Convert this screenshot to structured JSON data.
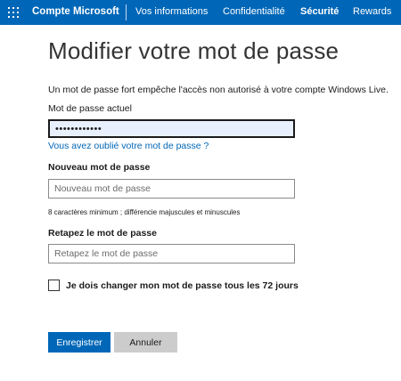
{
  "header": {
    "brand": "Compte Microsoft",
    "nav": [
      {
        "label": "Vos informations",
        "active": false
      },
      {
        "label": "Confidentialité",
        "active": false
      },
      {
        "label": "Sécurité",
        "active": true
      },
      {
        "label": "Rewards",
        "active": false
      }
    ]
  },
  "page": {
    "title": "Modifier votre mot de passe",
    "intro": "Un mot de passe fort empêche l'accès non autorisé à votre compte Windows Live."
  },
  "form": {
    "current_label": "Mot de passe actuel",
    "current_value": "••••••••••••",
    "forgot_link": "Vous avez oublié votre mot de passe ?",
    "new_label": "Nouveau mot de passe",
    "new_placeholder": "Nouveau mot de passe",
    "hint": "8 caractères minimum ; différencie majuscules et minuscules",
    "repeat_label": "Retapez le mot de passe",
    "repeat_placeholder": "Retapez le mot de passe",
    "expire_checkbox_label": "Je dois changer mon mot de passe tous les 72 jours",
    "expire_checked": false
  },
  "buttons": {
    "save": "Enregistrer",
    "cancel": "Annuler"
  },
  "colors": {
    "brand_blue": "#0067b8",
    "cancel_gray": "#cccccc",
    "autofill_bg": "#e8f0fe"
  },
  "icons": {
    "launcher": "app-launcher-waffle-icon"
  }
}
